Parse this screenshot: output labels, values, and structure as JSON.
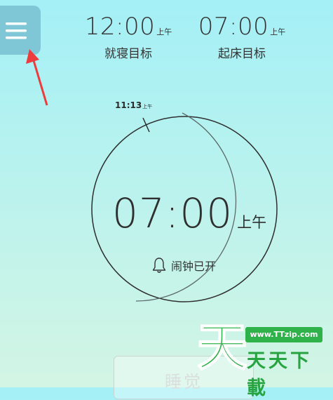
{
  "header": {
    "sleep_target": {
      "time": "12:00",
      "ampm": "上午",
      "label": "就寝目标"
    },
    "wake_target": {
      "time": "07:00",
      "ampm": "上午",
      "label": "起床目标"
    }
  },
  "dial": {
    "marker_time": "11:13",
    "marker_ampm": "上午",
    "alarm_time": "07:00",
    "alarm_ampm": "上午",
    "alarm_status": "闹钟已开"
  },
  "sleep_button": {
    "label": "睡觉"
  },
  "watermark": {
    "big_glyph": "天",
    "url": "www.TTzip.com",
    "text": "天天下載"
  },
  "colors": {
    "background_top": "#a4f0f6",
    "background_bottom": "#d3f5e4",
    "menu_button": "#7fc7d6",
    "annotation_arrow": "#ee3b3b",
    "watermark_green": "#2fb24a"
  },
  "icons": {
    "menu": "hamburger-icon",
    "alarm": "bell-icon"
  }
}
